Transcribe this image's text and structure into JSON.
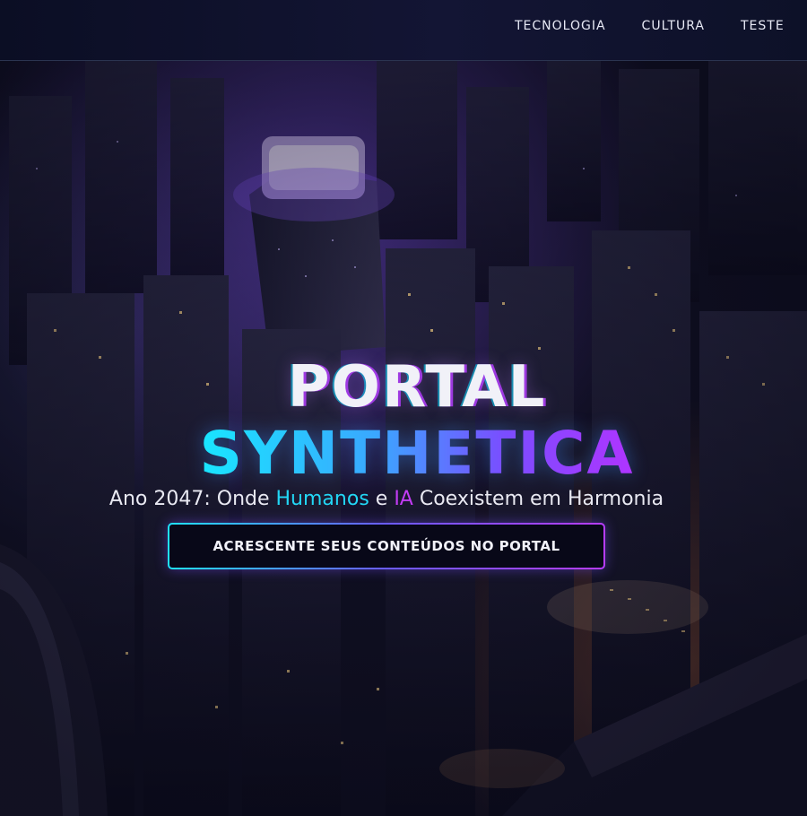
{
  "nav": {
    "links": [
      "TECNOLOGIA",
      "CULTURA",
      "TESTE"
    ]
  },
  "hero": {
    "title_line1": "PORTAL",
    "title_line2": "SYNTHETICA",
    "subtitle": {
      "part1": "Ano 2047: Onde ",
      "humanos": "Humanos",
      "part2": " e ",
      "ia": "IA",
      "part3": " Coexistem em Harmonia"
    },
    "cta_label": "ACRESCENTE SEUS CONTEÚDOS NO PORTAL"
  },
  "colors": {
    "accent_cyan": "#22d7f5",
    "accent_purple": "#c33cf5",
    "nav_bg": "#0b0e24"
  }
}
